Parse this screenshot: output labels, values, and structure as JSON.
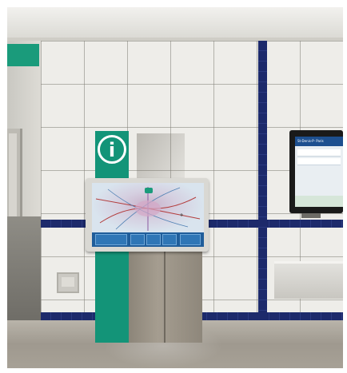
{
  "scene": {
    "description_free": true
  },
  "signs": {
    "info_symbol": "i",
    "right_screen_header": "St-Denis-P· Paris"
  },
  "icons": [
    "info-icon",
    "map-pin-icon"
  ],
  "colors": {
    "totem_green": "#139478",
    "tile_blue": "#1d2a6b",
    "screen_header_blue": "#1d4f8f",
    "map_bar_blue": "#1f5d9a"
  }
}
